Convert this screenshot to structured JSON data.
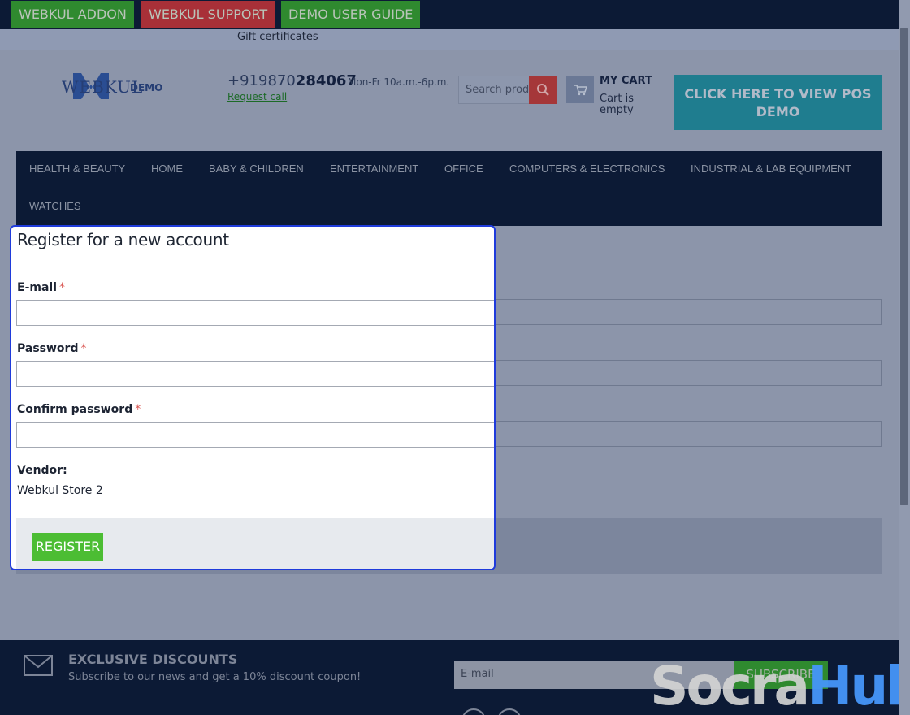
{
  "topbar": {
    "addon": "WEBKUL ADDON",
    "support": "WEBKUL SUPPORT",
    "guide": "DEMO USER GUIDE",
    "colors": {
      "addon": "#2f8a2f",
      "support": "#a83038"
    }
  },
  "giftbar": {
    "label": "Gift certificates"
  },
  "header": {
    "logo_word": "WEBKUL",
    "logo_demo": "DEMO",
    "phone_prefix": "+919870",
    "phone_suffix": "284067",
    "hours": "Mon-Fr 10a.m.-6p.m.",
    "request_call": "Request call",
    "search_placeholder": "Search prod",
    "my_cart": "MY CART",
    "cart_status": "Cart is empty",
    "pos_demo": "CLICK HERE TO VIEW POS DEMO"
  },
  "nav": {
    "items": [
      "HEALTH & BEAUTY",
      "HOME",
      "BABY & CHILDREN",
      "ENTERTAINMENT",
      "OFFICE",
      "COMPUTERS & ELECTRONICS",
      "INDUSTRIAL & LAB EQUIPMENT",
      "WATCHES"
    ]
  },
  "form": {
    "title": "Register for a new account",
    "email_label": "E-mail",
    "password_label": "Password",
    "confirm_label": "Confirm password",
    "required_mark": "*",
    "vendor_label": "Vendor:",
    "vendor_value": "Webkul Store 2",
    "register_label": "REGISTER",
    "highlight_color": "#1f3bdb"
  },
  "footer": {
    "title": "EXCLUSIVE DISCOUNTS",
    "subtitle": "Subscribe to our news and get a 10% discount coupon!",
    "email_placeholder": "E-mail",
    "subscribe_label": "SUBSCRIBE",
    "watermark_a": "Socra",
    "watermark_b": "Hub"
  }
}
